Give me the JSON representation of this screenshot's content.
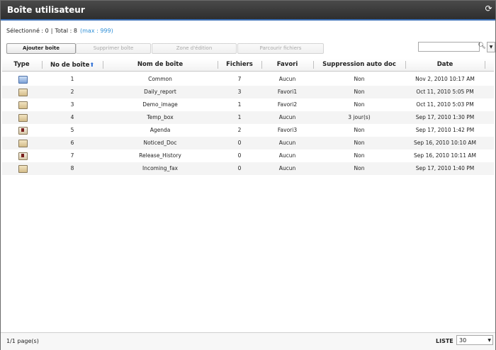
{
  "window": {
    "title": "Boîte utilisateur"
  },
  "icons": {
    "refresh": "refresh-icon",
    "search": "search-icon",
    "dropdown": "chevron-down-icon",
    "sort": "sort-ascending-icon"
  },
  "info": {
    "selected": "Sélectionné : 0",
    "total": "Total : 8",
    "max": "(max : 999)"
  },
  "toolbar": {
    "add": "Ajouter boîte",
    "delete": "Supprimer boîte",
    "edit_zone": "Zone d'édition",
    "browse": "Parcourir fichiers"
  },
  "search": {
    "value": "",
    "placeholder": ""
  },
  "columns": [
    "Type",
    "No de boîte",
    "Nom de boîte",
    "Fichiers",
    "Favori",
    "Suppression auto doc",
    "Date"
  ],
  "rows": [
    {
      "type": "special-box-icon",
      "no": "1",
      "name": "Common",
      "files": "7",
      "fav": "Aucun",
      "auto": "Non",
      "date": "Nov 2, 2010 10:17 AM"
    },
    {
      "type": "folder-box-icon",
      "no": "2",
      "name": "Daily_report",
      "files": "3",
      "fav": "Favori1",
      "auto": "Non",
      "date": "Oct 11, 2010 5:05 PM"
    },
    {
      "type": "folder-box-icon",
      "no": "3",
      "name": "Demo_image",
      "files": "1",
      "fav": "Favori2",
      "auto": "Non",
      "date": "Oct 11, 2010 5:03 PM"
    },
    {
      "type": "folder-box-icon",
      "no": "4",
      "name": "Temp_box",
      "files": "1",
      "fav": "Aucun",
      "auto": "3 jour(s)",
      "date": "Sep 17, 2010 1:30 PM"
    },
    {
      "type": "locked-box-icon",
      "no": "5",
      "name": "Agenda",
      "files": "2",
      "fav": "Favori3",
      "auto": "Non",
      "date": "Sep 17, 2010 1:42 PM"
    },
    {
      "type": "folder-box-icon",
      "no": "6",
      "name": "Noticed_Doc",
      "files": "0",
      "fav": "Aucun",
      "auto": "Non",
      "date": "Sep 16, 2010 10:10 AM"
    },
    {
      "type": "locked-box-icon",
      "no": "7",
      "name": "Release_History",
      "files": "0",
      "fav": "Aucun",
      "auto": "Non",
      "date": "Sep 16, 2010 10:11 AM"
    },
    {
      "type": "folder-box-icon",
      "no": "8",
      "name": "Incoming_fax",
      "files": "0",
      "fav": "Aucun",
      "auto": "Non",
      "date": "Sep 17, 2010 1:40 PM"
    }
  ],
  "footer": {
    "pages": "1/1 page(s)",
    "liste_label": "LISTE",
    "per_page": "30"
  },
  "colors": {
    "title_bar": "#333333",
    "accent": "#3b6fb5",
    "link": "#2f8fd6",
    "alt_row": "#f4f4f4"
  }
}
